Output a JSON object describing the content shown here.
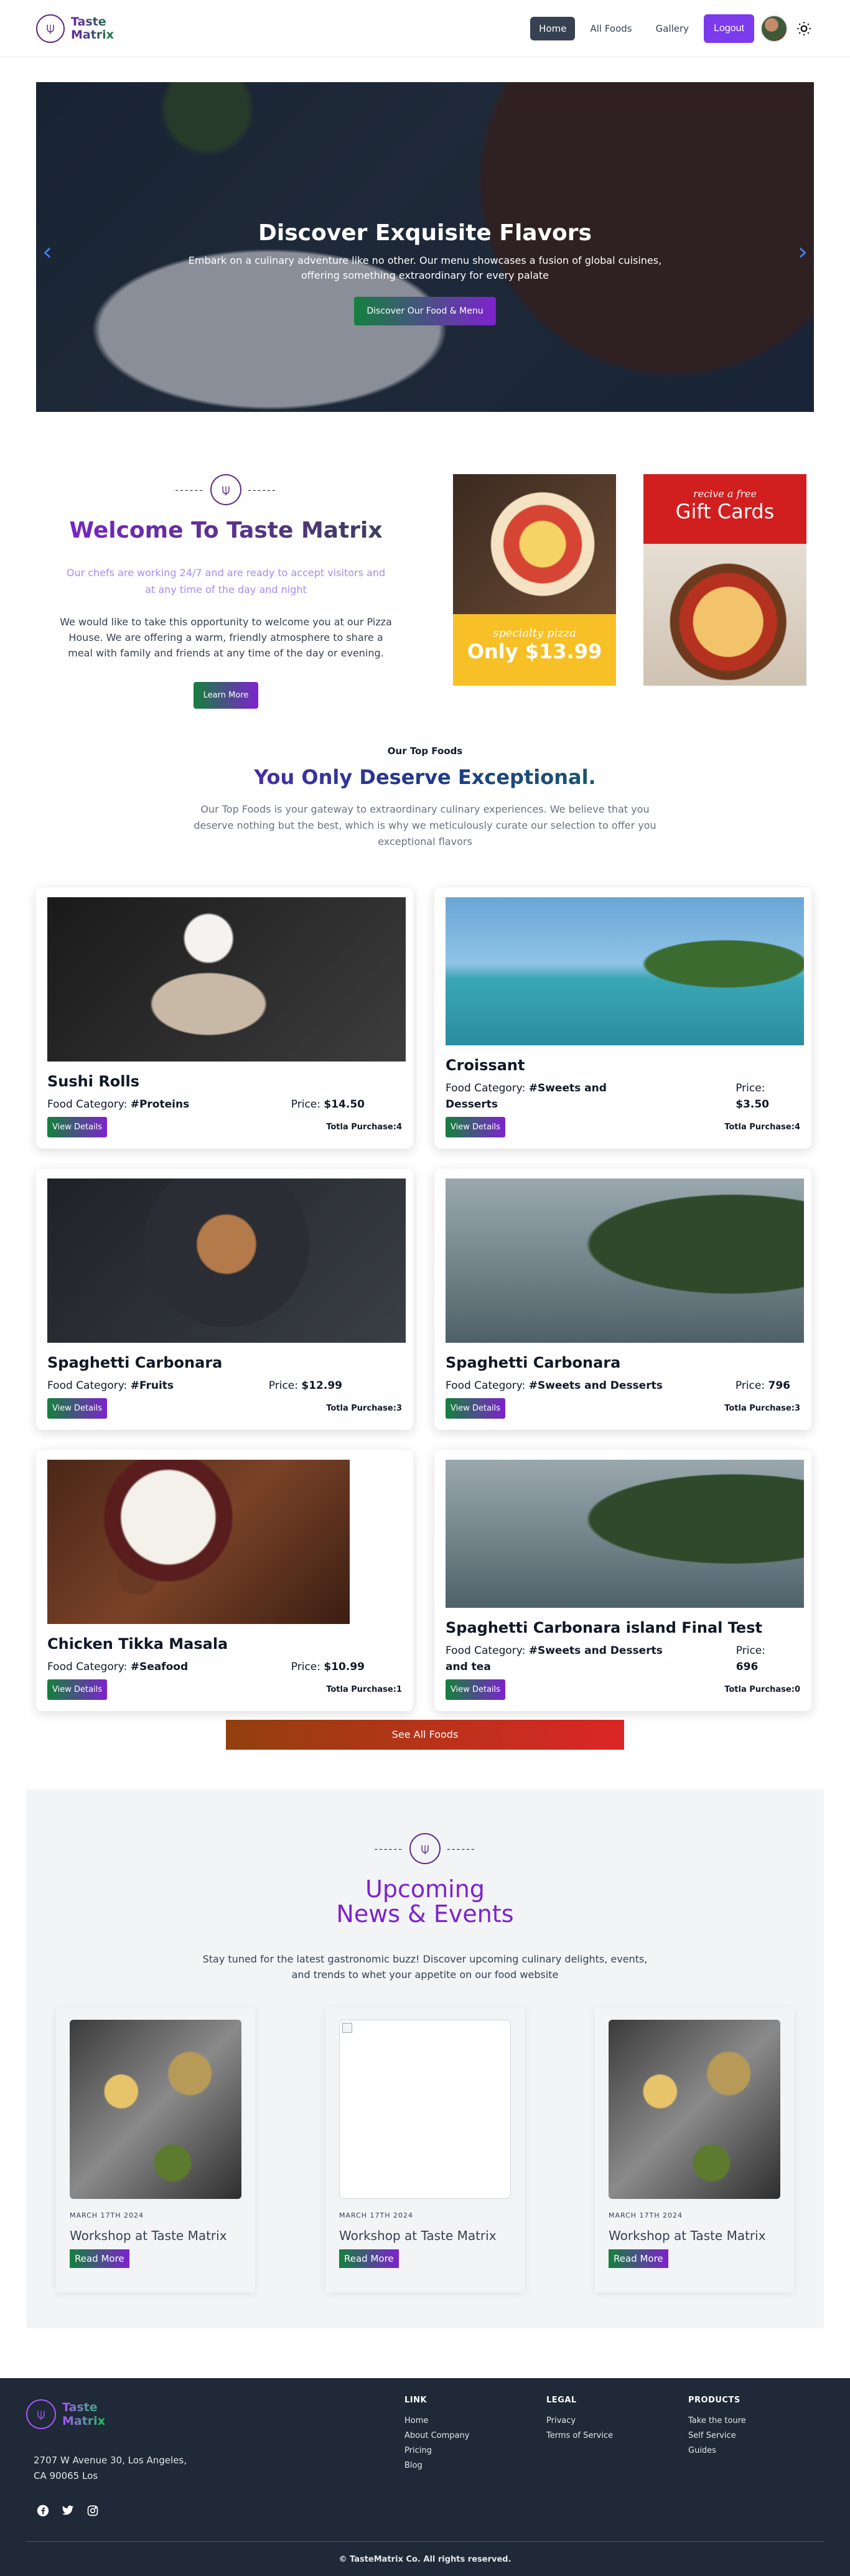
{
  "nav": {
    "brand_line1": "Taste",
    "brand_line2": "Matrix",
    "links": [
      "Home",
      "All Foods",
      "Gallery"
    ],
    "logout_label": "Logout"
  },
  "hero": {
    "title": "Discover Exquisite Flavors",
    "subtitle": "Embark on a culinary adventure like no other. Our menu showcases a fusion of global cuisines, offering something extraordinary for every palate",
    "cta_label": "Discover Our Food & Menu"
  },
  "welcome": {
    "title": "Welcome To Taste Matrix",
    "highlight": "Our chefs are working 24/7 and are ready to accept visitors and at any time of the day and night",
    "body": "We would like to take this opportunity to welcome you at our Pizza House. We are offering a warm, friendly atmosphere to share a meal with family and friends at any time of the day or evening.",
    "cta_label": "Learn More",
    "promo1_small": "specialty pizza",
    "promo1_big": "Only $13.99",
    "promo2_small": "recive a free",
    "promo2_big": "Gift Cards"
  },
  "top_foods": {
    "label": "Our Top Foods",
    "title": "You Only Deserve Exceptional.",
    "desc": "Our Top Foods is your gateway to extraordinary culinary experiences. We believe that you deserve nothing but the best, which is why we meticulously curate our selection to offer you exceptional flavors",
    "category_prefix": "Food Category: ",
    "price_prefix": "Price: ",
    "details_label": "View Details",
    "items": [
      {
        "name": "Sushi Rolls",
        "category": "#Proteins",
        "price": "$14.50",
        "purchase": "Totla Purchase:4"
      },
      {
        "name": "Croissant",
        "category": "#Sweets and Desserts",
        "price": "$3.50",
        "purchase": "Totla Purchase:4"
      },
      {
        "name": "Spaghetti Carbonara",
        "category": "#Fruits",
        "price": "$12.99",
        "purchase": "Totla Purchase:3"
      },
      {
        "name": "Spaghetti Carbonara",
        "category": "#Sweets and Desserts",
        "price": "796",
        "purchase": "Totla Purchase:3"
      },
      {
        "name": "Chicken Tikka Masala",
        "category": "#Seafood",
        "price": "$10.99",
        "purchase": "Totla Purchase:1"
      },
      {
        "name": "Spaghetti Carbonara island Final Test",
        "category": "#Sweets and Desserts and tea",
        "price": "696",
        "purchase": "Totla Purchase:0"
      }
    ],
    "see_all_label": "See All Foods"
  },
  "events": {
    "title_line1": "Upcoming",
    "title_line2": "News & Events",
    "desc": "Stay tuned for the latest gastronomic buzz! Discover upcoming culinary delights, events, and trends to whet your appetite on our food website",
    "read_more_label": "Read More",
    "items": [
      {
        "date": "MARCH 17TH 2024",
        "title": "Workshop at Taste Matrix"
      },
      {
        "date": "MARCH 17TH 2024",
        "title": "Workshop at Taste Matrix"
      },
      {
        "date": "MARCH 17TH 2024",
        "title": "Workshop at Taste Matrix"
      }
    ]
  },
  "footer": {
    "brand_line1": "Taste",
    "brand_line2": "Matrix",
    "address_line1": "2707 W Avenue 30, Los Angeles,",
    "address_line2": "CA 90065 Los",
    "columns": [
      {
        "title": "LINK",
        "links": [
          "Home",
          "About Company",
          "Pricing",
          "Blog"
        ]
      },
      {
        "title": "LEGAL",
        "links": [
          "Privacy",
          "Terms of Service"
        ]
      },
      {
        "title": "PRODUCTS",
        "links": [
          "Take the toure",
          "Self Service",
          "Guides"
        ]
      }
    ],
    "copyright": "© TasteMatrix Co. All rights reserved.",
    "social_icons": [
      "facebook-icon",
      "twitter-icon",
      "instagram-icon"
    ]
  }
}
